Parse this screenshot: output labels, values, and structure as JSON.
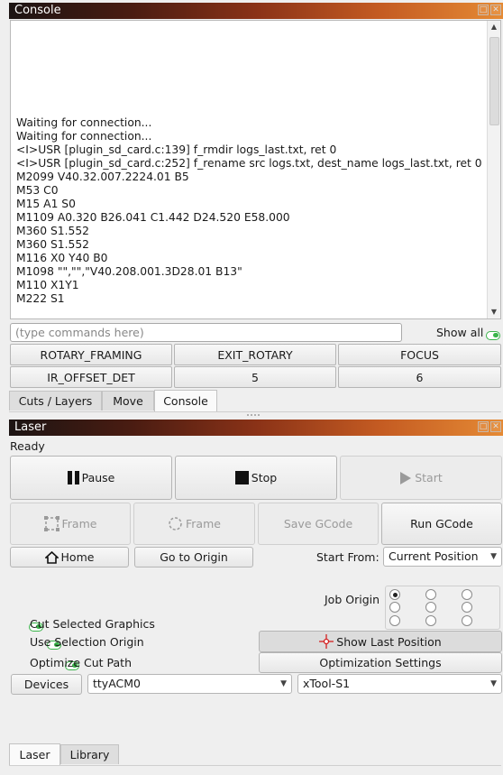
{
  "console_panel": {
    "title": "Console",
    "lines": [
      "Waiting for connection...",
      "Waiting for connection...",
      "<I>USR [plugin_sd_card.c:139] f_rmdir logs_last.txt, ret 0",
      "<I>USR [plugin_sd_card.c:252] f_rename src logs.txt, dest_name logs_last.txt, ret 0",
      "M2099 V40.32.007.2224.01 B5",
      "M53 C0",
      "M15 A1 S0",
      "M1109 A0.320 B26.041 C1.442 D24.520 E58.000",
      "M360 S1.552",
      "M360 S1.552",
      "M116 X0 Y40 B0",
      "M1098 \"\",\"\",\"V40.208.001.3D28.01 B13\"",
      "M110 X1Y1",
      "M222 S1"
    ],
    "command_placeholder": "(type commands here)",
    "command_value": "",
    "show_all_label": "Show all",
    "macro_buttons": [
      "ROTARY_FRAMING",
      "EXIT_ROTARY",
      "FOCUS",
      "IR_OFFSET_DET",
      "5",
      "6"
    ],
    "tabs": [
      "Cuts / Layers",
      "Move",
      "Console"
    ],
    "active_tab": "Console"
  },
  "laser_panel": {
    "title": "Laser",
    "status": "Ready",
    "pause_label": "Pause",
    "stop_label": "Stop",
    "start_label": "Start",
    "frame_label": "Frame",
    "rubber_frame_label": "Frame",
    "save_gcode_label": "Save GCode",
    "run_gcode_label": "Run GCode",
    "home_label": "Home",
    "go_to_origin_label": "Go to Origin",
    "start_from_label": "Start From:",
    "start_from_value": "Current Position",
    "job_origin_label": "Job Origin",
    "job_origin_selected": "top-left",
    "cut_selected_label": "Cut Selected Graphics",
    "use_selection_origin_label": "Use Selection Origin",
    "optimize_cut_path_label": "Optimize Cut Path",
    "show_last_position_label": "Show Last Position",
    "optimization_settings_label": "Optimization Settings",
    "devices_label": "Devices",
    "port_value": "ttyACM0",
    "device_value": "xTool-S1",
    "tabs": [
      "Laser",
      "Library"
    ],
    "active_tab": "Laser"
  },
  "colors": {
    "toggle_on": "#3ab44a",
    "title_gradient_start": "#1c1413",
    "title_gradient_end": "#e58a34"
  }
}
